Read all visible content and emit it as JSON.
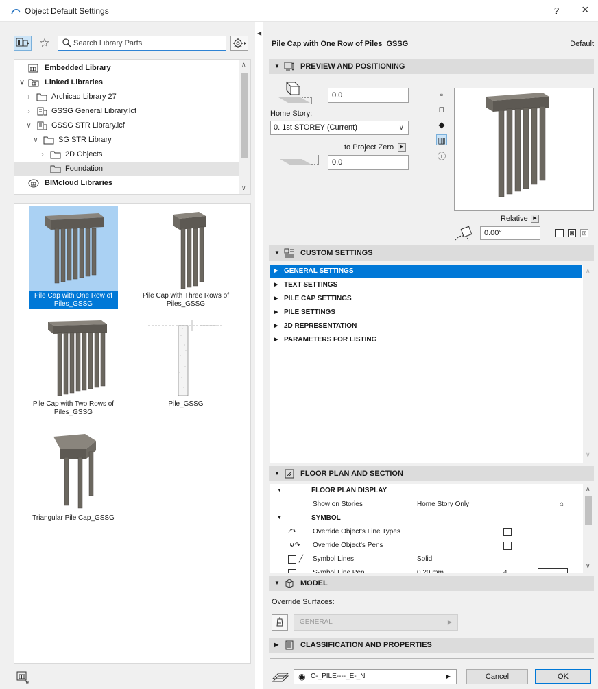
{
  "window": {
    "title": "Object Default Settings",
    "help": "?",
    "close": "×"
  },
  "library": {
    "search_placeholder": "Search Library Parts",
    "tree": [
      {
        "label": "Embedded Library",
        "bold": true
      },
      {
        "label": "Linked Libraries",
        "bold": true
      },
      {
        "label": "Archicad Library 27"
      },
      {
        "label": "GSSG General Library.lcf"
      },
      {
        "label": "GSSG STR Library.lcf"
      },
      {
        "label": "SG STR Library"
      },
      {
        "label": "2D Objects"
      },
      {
        "label": "Foundation",
        "selected": true
      },
      {
        "label": "BIMcloud Libraries",
        "bold": true
      }
    ],
    "objects": [
      {
        "label": "Pile Cap with One Row of Piles_GSSG",
        "selected": true
      },
      {
        "label": "Pile Cap with Three Rows of Piles_GSSG"
      },
      {
        "label": "Pile Cap with Two Rows of Piles_GSSG"
      },
      {
        "label": "Pile_GSSG"
      },
      {
        "label": "Triangular Pile Cap_GSSG"
      }
    ]
  },
  "settings": {
    "object_name": "Pile Cap with One Row of Piles_GSSG",
    "default_label": "Default",
    "preview_section": {
      "label": "PREVIEW AND POSITIONING",
      "top_offset": "0.0",
      "home_story_label": "Home Story:",
      "home_story_value": "0. 1st STOREY (Current)",
      "to_project_zero": "to Project Zero",
      "bottom_offset": "0.0",
      "relative_label": "Relative",
      "angle": "0.00°"
    },
    "custom_section": {
      "label": "CUSTOM SETTINGS",
      "items": [
        {
          "label": "GENERAL SETTINGS",
          "selected": true
        },
        {
          "label": "TEXT SETTINGS"
        },
        {
          "label": "PILE CAP SETTINGS"
        },
        {
          "label": "PILE SETTINGS"
        },
        {
          "label": "2D REPRESENTATION"
        },
        {
          "label": "PARAMETERS FOR LISTING"
        }
      ]
    },
    "floor_plan_section": {
      "label": "FLOOR PLAN AND SECTION",
      "floor_plan_display": "FLOOR PLAN DISPLAY",
      "show_on_stories": "Show on Stories",
      "show_on_stories_value": "Home Story Only",
      "symbol": "SYMBOL",
      "override_line_types": "Override Object's Line Types",
      "override_pens": "Override Object's Pens",
      "symbol_lines": "Symbol Lines",
      "symbol_lines_value": "Solid",
      "symbol_line_pen": "Symbol Line Pen",
      "symbol_line_pen_value": "0.20 mm",
      "symbol_line_pen_number": "4"
    },
    "model_section": {
      "label": "MODEL",
      "override_surfaces": "Override Surfaces:",
      "surface_value": "GENERAL"
    },
    "classification_section": {
      "label": "CLASSIFICATION AND PROPERTIES"
    },
    "layer_value": "C-_PILE----_E-_N",
    "cancel_label": "Cancel",
    "ok_label": "OK"
  },
  "colors": {
    "selection": "#0078d7",
    "selected_tile_bg": "#aad1f3",
    "section_header": "#dcdcdc",
    "panel_bg": "#f0f0f0"
  },
  "icons": [
    "archicad-logo-icon",
    "library-view-icon",
    "favorites-star-icon",
    "search-icon",
    "library-settings-gear-icon",
    "close-icon"
  ]
}
